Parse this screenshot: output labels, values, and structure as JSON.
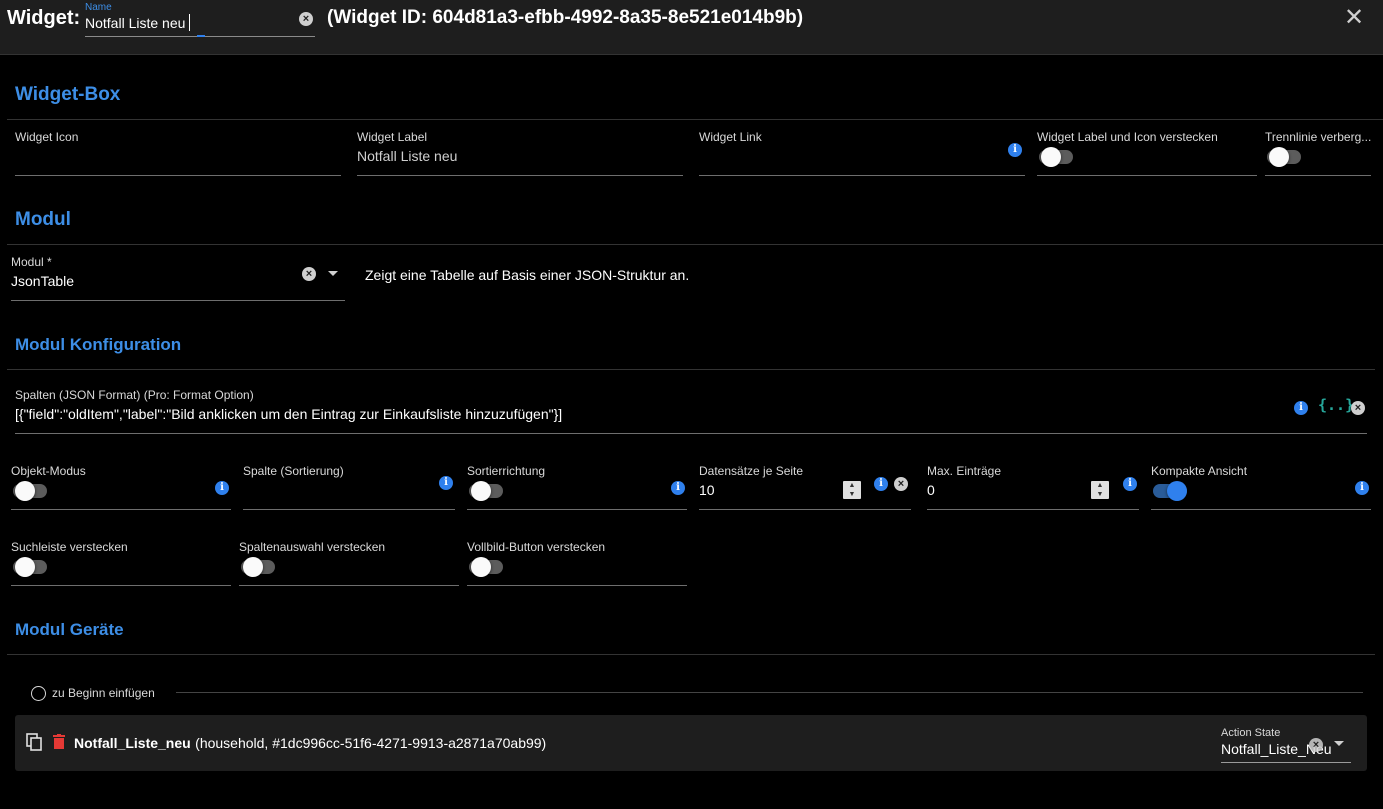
{
  "header": {
    "title": "Widget:",
    "name_caption": "Name",
    "name_value": "Notfall Liste neu",
    "widget_id": "(Widget ID: 604d81a3-efbb-4992-8a35-8e521e014b9b)"
  },
  "widget_box": {
    "title": "Widget-Box",
    "icon_label": "Widget Icon",
    "label_label": "Widget Label",
    "label_value": "Notfall Liste neu",
    "link_label": "Widget Link",
    "hide_label_icon_label": "Widget Label und Icon verstecken",
    "hide_label_icon_on": false,
    "hide_divider_label": "Trennlinie verberg...",
    "hide_divider_on": false
  },
  "modul": {
    "title": "Modul",
    "select_label": "Modul *",
    "select_value": "JsonTable",
    "description": "Zeigt eine Tabelle auf Basis einer JSON-Struktur an."
  },
  "config": {
    "title": "Modul Konfiguration",
    "columns_label": "Spalten (JSON Format) (Pro: Format Option)",
    "columns_value": "[{\"field\":\"oldItem\",\"label\":\"Bild anklicken um den Eintrag zur Einkaufsliste hinzuzufügen\"}]",
    "json_icon_text": "{..}",
    "object_mode_label": "Objekt-Modus",
    "object_mode_on": false,
    "sort_column_label": "Spalte (Sortierung)",
    "sort_direction_label": "Sortierrichtung",
    "sort_direction_on": false,
    "rows_per_page_label": "Datensätze je Seite",
    "rows_per_page_value": "10",
    "max_entries_label": "Max. Einträge",
    "max_entries_value": "0",
    "compact_label": "Kompakte Ansicht",
    "compact_on": true,
    "hide_search_label": "Suchleiste verstecken",
    "hide_search_on": false,
    "hide_columns_label": "Spaltenauswahl verstecken",
    "hide_columns_on": false,
    "hide_fullscreen_label": "Vollbild-Button verstecken",
    "hide_fullscreen_on": false
  },
  "devices": {
    "title": "Modul Geräte",
    "insert_label": "zu Beginn einfügen",
    "items": [
      {
        "name": "Notfall_Liste_neu",
        "meta": "(household, #1dc996cc-51f6-4271-9913-a2871a70ab99)",
        "action_label": "Action State",
        "action_value": "Notfall_Liste_Neu"
      }
    ]
  },
  "colors": {
    "accent": "#3d8ee6",
    "header_bg": "#1e1e1e",
    "delete": "#e53935",
    "json_icon": "#26a69a"
  }
}
